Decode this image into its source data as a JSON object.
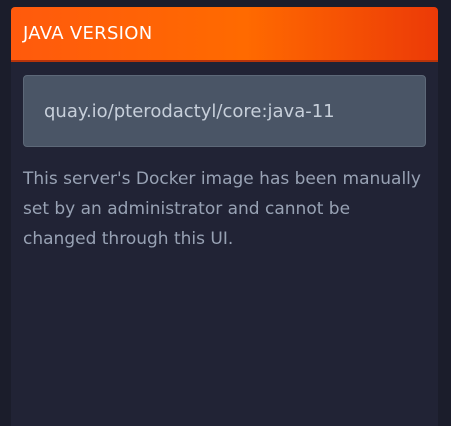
{
  "card": {
    "title": "JAVA VERSION",
    "image_field": {
      "value": "quay.io/pterodactyl/core:java-11",
      "readonly": true
    },
    "helper_text": "This server's Docker image has been manually set by an administrator and cannot be changed through this UI."
  },
  "colors": {
    "header_gradient_start": "#ff5a0d",
    "header_gradient_end": "#ec3a07",
    "page_background": "#1b1d2b",
    "card_background": "#212335",
    "input_background": "#4a5566",
    "helper_text": "#98a2b4"
  }
}
